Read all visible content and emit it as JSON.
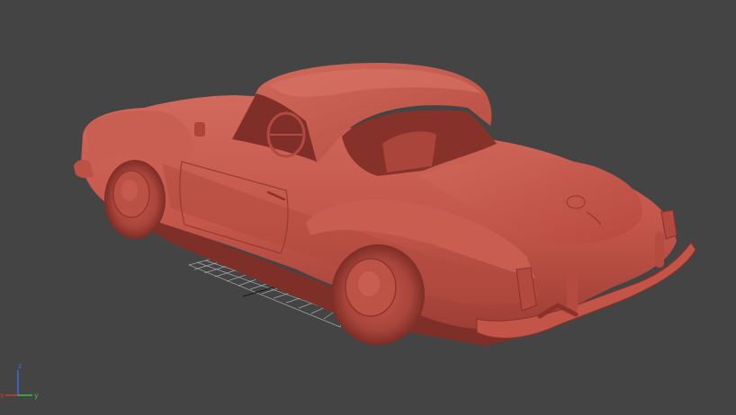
{
  "viewport": {
    "background": "#444444",
    "model_color": "#c4564a",
    "model_shadow": "#8e342c",
    "model_highlight": "#d9776a",
    "grid_color": "#b9b9b9"
  },
  "gizmo": {
    "x_label": "x",
    "y_label": "y",
    "z_label": "z",
    "x_color": "#d8382c",
    "y_color": "#35c43a",
    "z_color": "#3a6cf0"
  }
}
